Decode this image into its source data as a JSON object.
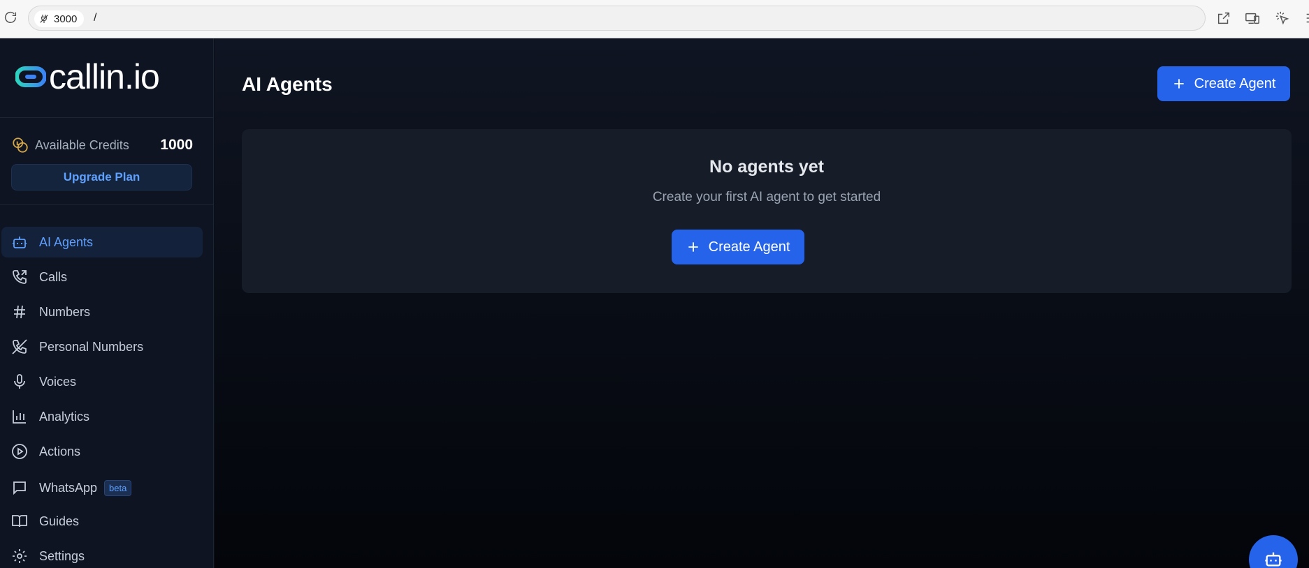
{
  "browser": {
    "port": "3000",
    "path": "/"
  },
  "sidebar": {
    "logo_text": "callin.io",
    "credits_label": "Available Credits",
    "credits_value": "1000",
    "upgrade_label": "Upgrade Plan",
    "items": [
      {
        "label": "AI Agents",
        "icon": "bot-icon",
        "active": true
      },
      {
        "label": "Calls",
        "icon": "phone-call-icon"
      },
      {
        "label": "Numbers",
        "icon": "hash-icon"
      },
      {
        "label": "Personal Numbers",
        "icon": "phone-off-icon"
      },
      {
        "label": "Voices",
        "icon": "microphone-icon"
      },
      {
        "label": "Analytics",
        "icon": "bar-chart-icon"
      },
      {
        "label": "Actions",
        "icon": "play-circle-icon"
      },
      {
        "label": "WhatsApp",
        "icon": "message-square-icon",
        "badge": "beta"
      },
      {
        "label": "Guides",
        "icon": "book-open-icon"
      },
      {
        "label": "Settings",
        "icon": "gear-icon"
      }
    ]
  },
  "main": {
    "title": "AI Agents",
    "create_button": "Create Agent",
    "empty_title": "No agents yet",
    "empty_subtitle": "Create your first AI agent to get started",
    "empty_button": "Create Agent"
  },
  "colors": {
    "accent": "#2563eb",
    "active_text": "#5ea0ff",
    "sidebar_bg": "#0e1421",
    "card_bg": "#161c28"
  }
}
